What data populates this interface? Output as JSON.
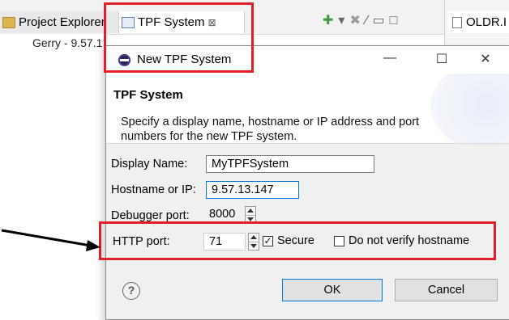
{
  "workbench": {
    "tab_project_explorer": "Project Explorer",
    "tab_tpf_system": "TPF System",
    "tab_close": "⊠",
    "tab_right": "OLDR.I",
    "tree_item": "Gerry - 9.57.1"
  },
  "dialog": {
    "title": "New TPF System",
    "minimize": "—",
    "maximize": "☐",
    "close": "✕",
    "wizard_title": "TPF System",
    "wizard_description": "Specify a display name, hostname or IP address and port numbers for the new TPF system.",
    "display_name_label": "Display Name:",
    "display_name_value": "MyTPFSystem",
    "hostname_label": "Hostname or IP:",
    "hostname_value": "9.57.13.147",
    "debugger_port_label": "Debugger port:",
    "debugger_port_value": "8000",
    "http_port_label": "HTTP port:",
    "http_port_value": "71",
    "secure_label": "Secure",
    "secure_checked": true,
    "secure_mark": "✓",
    "no_verify_label": "Do not verify hostname",
    "no_verify_checked": false,
    "help_symbol": "?",
    "ok_label": "OK",
    "cancel_label": "Cancel"
  },
  "colors": {
    "highlight_red": "#e11f28",
    "focus_blue": "#0078d7"
  }
}
